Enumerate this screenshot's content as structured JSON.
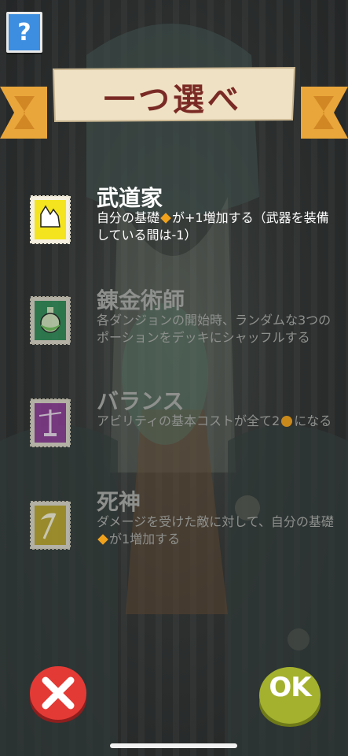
{
  "help": {
    "label": "?"
  },
  "banner": {
    "title": "一つ選べ"
  },
  "options": [
    {
      "title": "武道家",
      "desc_a": "自分の基礎",
      "desc_b": "が+1増加する（武器を装備している間は-1）",
      "icon": "fist-icon",
      "selected": true
    },
    {
      "title": "錬金術師",
      "desc": "各ダンジョンの開始時、ランダムな3つのポーションをデッキにシャッフルする",
      "icon": "potion-icon",
      "selected": false
    },
    {
      "title": "バランス",
      "desc_a": "アビリティの基本コストが全て2",
      "desc_b": "になる",
      "icon": "scales-icon",
      "selected": false
    },
    {
      "title": "死神",
      "desc_a": "ダメージを受けた敵に対して、自分の基礎",
      "desc_b": "が1増加する",
      "icon": "scythe-icon",
      "selected": false
    }
  ],
  "buttons": {
    "ok": "OK"
  },
  "colors": {
    "stamp_yellow": "#f3e41f",
    "stamp_green": "#2e8a55",
    "stamp_purple": "#8a3a93",
    "stamp_olive": "#b8a32a",
    "accent_orange": "#f0a21c"
  }
}
